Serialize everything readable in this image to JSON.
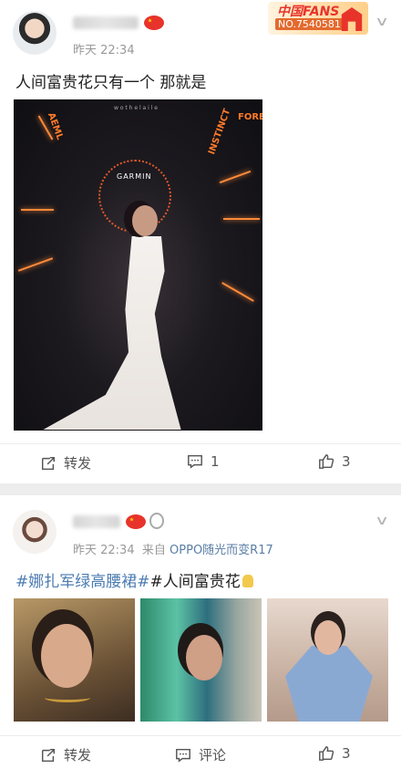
{
  "post1": {
    "time": "昨天 22:34",
    "badge_tag": "中国FANS",
    "badge_number": "NO.7540581",
    "text": "人间富贵花只有一个  那就是",
    "photo_brand": "GARMIN",
    "photo_top_text": "w o t h e   l a i l e",
    "photo_sign_left": "AEML",
    "photo_sign_right1": "INSTINCT",
    "photo_sign_right2": "FORE",
    "repost_label": "转发",
    "comment_count": "1",
    "like_count": "3"
  },
  "post2": {
    "time": "昨天 22:34",
    "source_prefix": "来自",
    "source": "OPPO随光而变R17",
    "hashtag1": "#娜扎军绿高腰裙#",
    "hashtag2": "#人间富贵花",
    "repost_label": "转发",
    "comment_label": "评论",
    "like_count": "3"
  },
  "icons": {
    "more": "chevron-down-icon",
    "repost": "repost-icon",
    "comment": "comment-icon",
    "like": "thumbs-up-icon",
    "medal": "medal-icon"
  },
  "colors": {
    "hashtag": "#4b7bb2",
    "source": "#5a7ea6",
    "flag": "#e8332b"
  }
}
